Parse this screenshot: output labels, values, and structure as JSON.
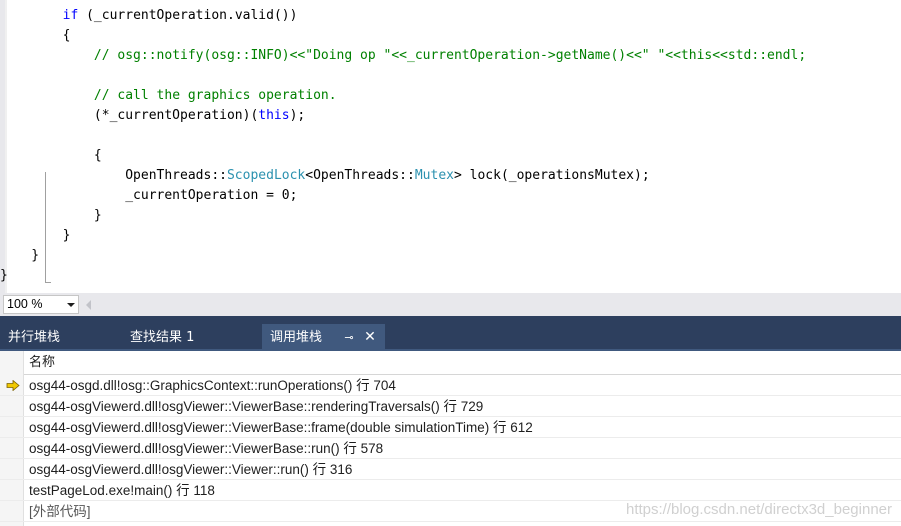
{
  "editor": {
    "lines": [
      [
        {
          "t": "        "
        },
        {
          "t": "if",
          "c": "kw"
        },
        {
          "t": " (_currentOperation.valid())"
        }
      ],
      [
        {
          "t": "        {"
        }
      ],
      [
        {
          "t": "            "
        },
        {
          "t": "// osg::notify(osg::INFO)<<\"Doing op \"<<_currentOperation->getName()<<\" \"<<this<<std::endl;",
          "c": "cm"
        }
      ],
      [
        {
          "t": ""
        }
      ],
      [
        {
          "t": "            "
        },
        {
          "t": "// call the graphics operation.",
          "c": "cm"
        }
      ],
      [
        {
          "t": "            (*_currentOperation)("
        },
        {
          "t": "this",
          "c": "kw"
        },
        {
          "t": ");"
        }
      ],
      [
        {
          "t": ""
        }
      ],
      [
        {
          "t": "            {"
        }
      ],
      [
        {
          "t": "                OpenThreads::"
        },
        {
          "t": "ScopedLock",
          "c": "ty"
        },
        {
          "t": "<OpenThreads::"
        },
        {
          "t": "Mutex",
          "c": "ty"
        },
        {
          "t": "> lock(_operationsMutex);"
        }
      ],
      [
        {
          "t": "                _currentOperation = 0;"
        }
      ],
      [
        {
          "t": "            }"
        }
      ],
      [
        {
          "t": "        }"
        }
      ],
      [
        {
          "t": "    }"
        }
      ],
      [
        {
          "t": "}"
        }
      ]
    ]
  },
  "zoom": {
    "value": "100 %"
  },
  "toolwindow": {
    "tabs": [
      {
        "label": "并行堆栈"
      },
      {
        "label": "查找结果 1"
      },
      {
        "label": "调用堆栈",
        "active": true
      }
    ],
    "pin_glyph": "⊸",
    "close_glyph": "✕",
    "column_header": "名称",
    "rows": [
      {
        "text": "osg44-osgd.dll!osg::GraphicsContext::runOperations() 行 704",
        "current": true
      },
      {
        "text": "osg44-osgViewerd.dll!osgViewer::ViewerBase::renderingTraversals() 行 729"
      },
      {
        "text": "osg44-osgViewerd.dll!osgViewer::ViewerBase::frame(double simulationTime) 行 612"
      },
      {
        "text": "osg44-osgViewerd.dll!osgViewer::ViewerBase::run() 行 578"
      },
      {
        "text": "osg44-osgViewerd.dll!osgViewer::Viewer::run() 行 316"
      },
      {
        "text": "testPageLod.exe!main() 行 118"
      },
      {
        "text": "[外部代码]",
        "external": true
      }
    ],
    "watermark": "https://blog.csdn.net/directx3d_beginner"
  },
  "colors": {
    "keyword": "#0000ff",
    "comment": "#008000",
    "type": "#2b91af",
    "tab_strip": "#2d3f5e",
    "active_tab": "#40597e",
    "current_frame_arrow": "#f0c800"
  }
}
